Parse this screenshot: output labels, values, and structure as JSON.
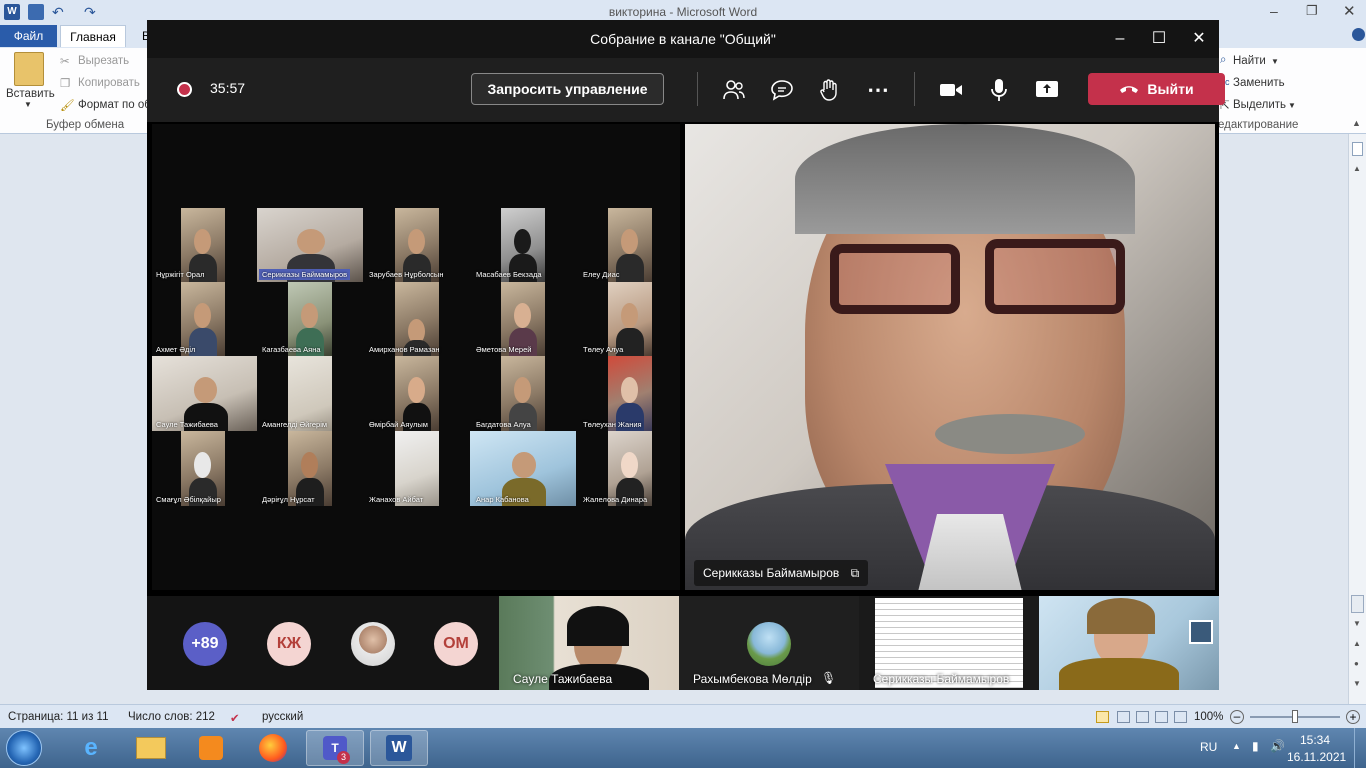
{
  "word": {
    "title": "викторина  -  Microsoft Word",
    "tabs": {
      "file": "Файл",
      "home": "Главная",
      "partial": "В"
    },
    "clipboard": {
      "paste": "Вставить",
      "cut": "Вырезать",
      "copy": "Копировать",
      "format_painter": "Формат по об",
      "group": "Буфер обмена"
    },
    "editing": {
      "find": "Найти",
      "replace": "Заменить",
      "select": "Выделить",
      "group": "едактирование"
    },
    "status": {
      "page": "Страница: 11 из 11",
      "words": "Число слов: 212",
      "lang": "русский",
      "zoom": "100%"
    }
  },
  "taskbar": {
    "lang": "RU",
    "time": "15:34",
    "date": "16.11.2021",
    "teams_badge": "3"
  },
  "teams": {
    "title": "Собрание в канале \"Общий\"",
    "timer": "35:57",
    "request_control": "Запросить управление",
    "leave": "Выйти",
    "gallery": [
      {
        "name": "Нұржігіт Орал"
      },
      {
        "name": "Серикказы Баймамыров"
      },
      {
        "name": "Зарубаев Нұрболсын"
      },
      {
        "name": "Масабаев Бекзада"
      },
      {
        "name": "Елеу Диас"
      },
      {
        "name": "Ахмет Әділ"
      },
      {
        "name": "Кагазбаева Аяна"
      },
      {
        "name": "Амирханов Рамазан"
      },
      {
        "name": "Әметова Мерей"
      },
      {
        "name": "Төлеу Алуа"
      },
      {
        "name": "Сауле Тажибаева"
      },
      {
        "name": "Амангелді Әйгерім"
      },
      {
        "name": "Өмірбай Аяулым"
      },
      {
        "name": "Багдатова Алуа"
      },
      {
        "name": "Төлеухан Жания"
      },
      {
        "name": "Смағұл Әбілқайыр"
      },
      {
        "name": "Дәріғұл Нұрсат"
      },
      {
        "name": "Жанахов Айбат"
      },
      {
        "name": "Анар Кабанова"
      },
      {
        "name": "Жалелова Динара"
      }
    ],
    "main_speaker": "Серикказы Баймамыров",
    "bottom": {
      "more_count": "+89",
      "av1": "КЖ",
      "av3": "ОМ",
      "tile1": "Сауле Тажибаева",
      "tile2": "Рахымбекова Мөлдір",
      "tile3": "Серикказы Баймамыров"
    }
  }
}
